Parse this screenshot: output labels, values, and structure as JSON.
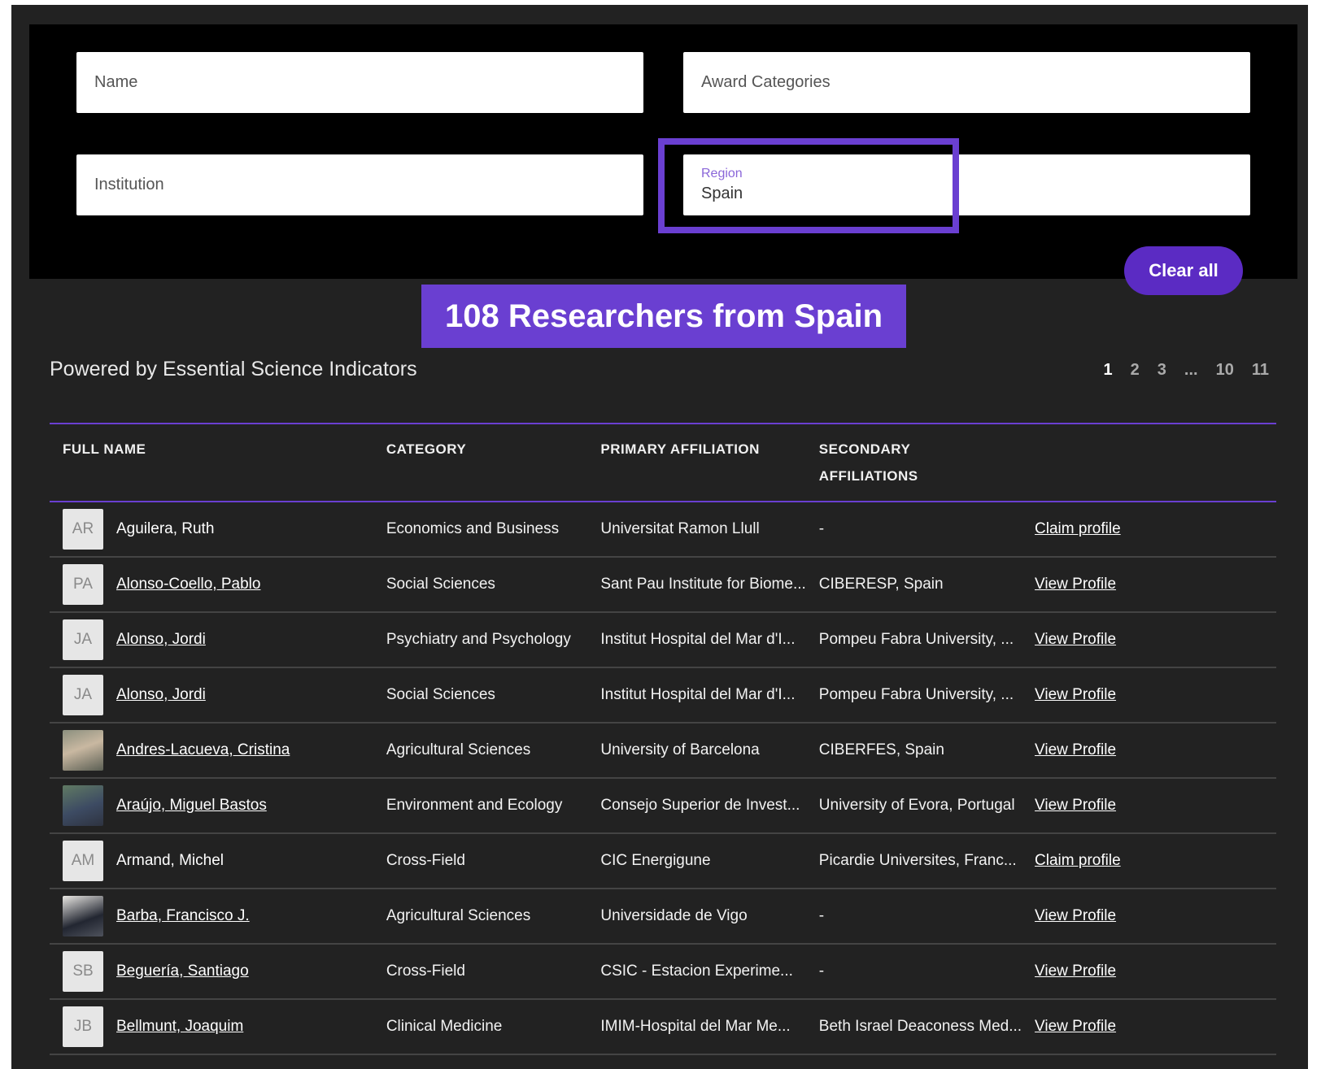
{
  "filters": {
    "name_placeholder": "Name",
    "award_placeholder": "Award Categories",
    "institution_placeholder": "Institution",
    "region_label": "Region",
    "region_value": "Spain",
    "clear_all_label": "Clear all"
  },
  "banner_text": "108 Researchers from Spain",
  "powered_by": "Powered by Essential Science Indicators",
  "pagination": [
    "1",
    "2",
    "3",
    "...",
    "10",
    "11"
  ],
  "table": {
    "headers": [
      "FULL NAME",
      "CATEGORY",
      "PRIMARY AFFILIATION",
      "SECONDARY AFFILIATIONS",
      ""
    ],
    "rows": [
      {
        "initials": "AR",
        "name": "Aguilera, Ruth",
        "name_linked": false,
        "photo": false,
        "category": "Economics and Business",
        "primary": "Universitat Ramon Llull",
        "secondary": "-",
        "action": "Claim profile"
      },
      {
        "initials": "PA",
        "name": "Alonso-Coello, Pablo",
        "name_linked": true,
        "photo": false,
        "category": "Social Sciences",
        "primary": "Sant Pau Institute for Biome...",
        "secondary": "CIBERESP, Spain",
        "action": "View Profile"
      },
      {
        "initials": "JA",
        "name": "Alonso, Jordi",
        "name_linked": true,
        "photo": false,
        "category": "Psychiatry and Psychology",
        "primary": "Institut Hospital del Mar d'I...",
        "secondary": "Pompeu Fabra University, ...",
        "action": "View Profile"
      },
      {
        "initials": "JA",
        "name": "Alonso, Jordi",
        "name_linked": true,
        "photo": false,
        "category": "Social Sciences",
        "primary": "Institut Hospital del Mar d'I...",
        "secondary": "Pompeu Fabra University, ...",
        "action": "View Profile"
      },
      {
        "initials": "",
        "name": "Andres-Lacueva, Cristina",
        "name_linked": true,
        "photo": true,
        "category": "Agricultural Sciences",
        "primary": "University of Barcelona",
        "secondary": "CIBERFES, Spain",
        "action": "View Profile"
      },
      {
        "initials": "",
        "name": "Araújo, Miguel Bastos",
        "name_linked": true,
        "photo": true,
        "category": "Environment and Ecology",
        "primary": "Consejo Superior de Invest...",
        "secondary": "University of Evora, Portugal",
        "action": "View Profile"
      },
      {
        "initials": "AM",
        "name": "Armand, Michel",
        "name_linked": false,
        "photo": false,
        "category": "Cross-Field",
        "primary": "CIC Energigune",
        "secondary": "Picardie Universites, Franc...",
        "action": "Claim profile"
      },
      {
        "initials": "",
        "name": "Barba, Francisco J.",
        "name_linked": true,
        "photo": true,
        "category": "Agricultural Sciences",
        "primary": "Universidade de Vigo",
        "secondary": "-",
        "action": "View Profile"
      },
      {
        "initials": "SB",
        "name": "Beguería, Santiago",
        "name_linked": true,
        "photo": false,
        "category": "Cross-Field",
        "primary": "CSIC - Estacion Experime...",
        "secondary": "-",
        "action": "View Profile"
      },
      {
        "initials": "JB",
        "name": "Bellmunt, Joaquim",
        "name_linked": true,
        "photo": false,
        "category": "Clinical Medicine",
        "primary": "IMIM-Hospital del Mar Me...",
        "secondary": "Beth Israel Deaconess Med...",
        "action": "View Profile"
      }
    ]
  },
  "colors": {
    "accent": "#6a3fd1",
    "button": "#5b2bc3",
    "panel": "#000000",
    "background": "#222222"
  }
}
